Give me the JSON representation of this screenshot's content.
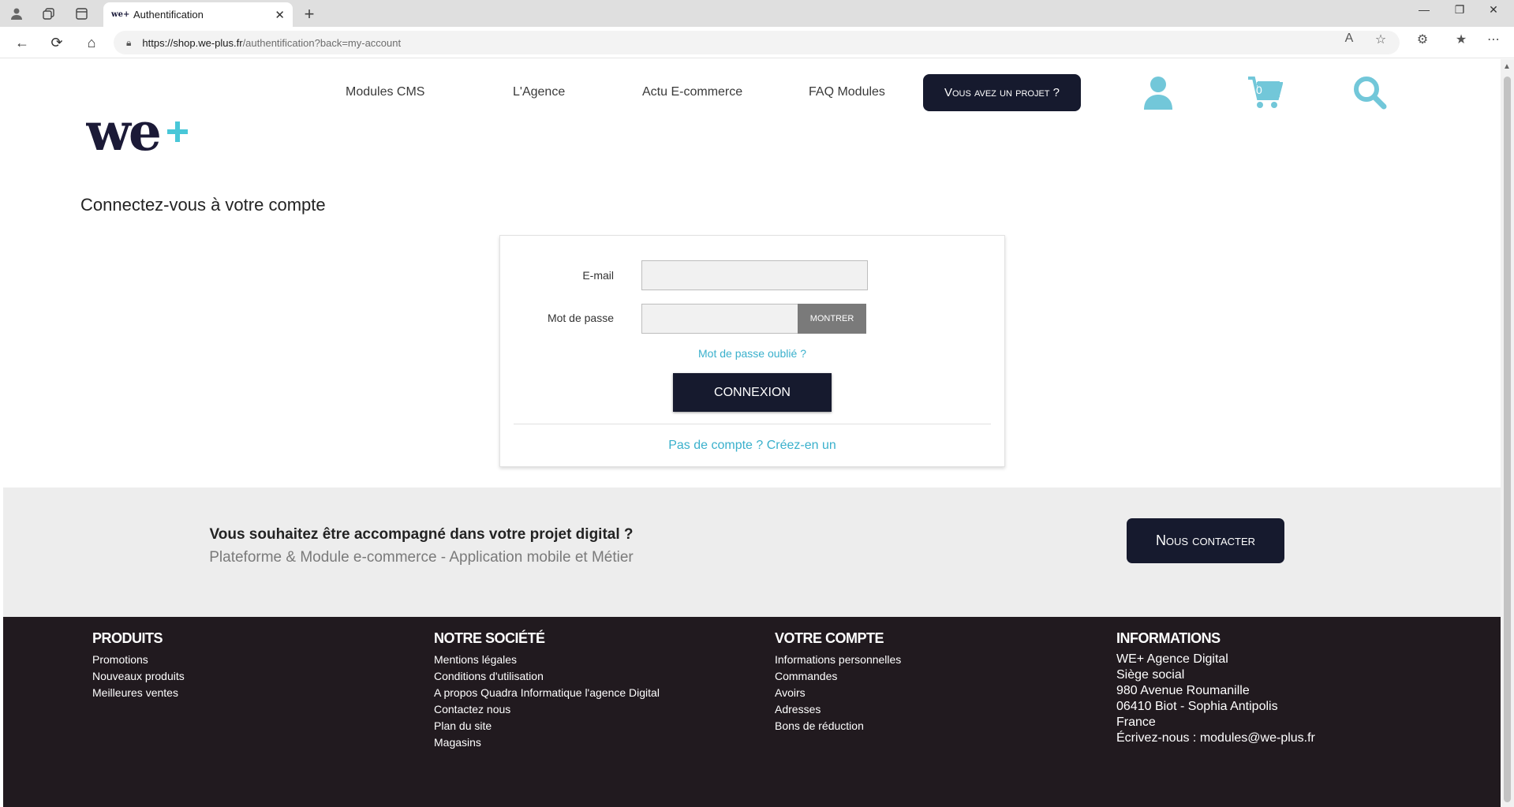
{
  "browser": {
    "tab_title": "Authentification",
    "tab_favicon": "we+",
    "url_host": "https://shop.we-plus.fr",
    "url_path": "/authentification?back=my-account"
  },
  "header": {
    "menu": [
      "Modules CMS",
      "L'Agence",
      "Actu E-commerce",
      "FAQ Modules"
    ],
    "project_button": "Vous avez un projet ?",
    "cart_count": "0",
    "logo_text": "we+"
  },
  "main": {
    "title": "Connectez-vous à votre compte",
    "email_label": "E-mail",
    "password_label": "Mot de passe",
    "email_value": "",
    "password_value": "",
    "show_button": "MONTRER",
    "forgot_link": "Mot de passe oublié ?",
    "submit_button": "CONNEXION",
    "create_account_link": "Pas de compte ? Créez-en un"
  },
  "cta": {
    "title": "Vous souhaitez être accompagné dans votre projet digital ?",
    "subtitle": "Plateforme & Module e-commerce - Application mobile et Métier",
    "button": "Nous contacter"
  },
  "footer": {
    "produits": {
      "title": "PRODUITS",
      "links": [
        "Promotions",
        "Nouveaux produits",
        "Meilleures ventes"
      ]
    },
    "societe": {
      "title": "NOTRE SOCIÉTÉ",
      "links": [
        "Mentions légales",
        "Conditions d'utilisation",
        "A propos Quadra Informatique l'agence Digital",
        "Contactez nous",
        "Plan du site",
        "Magasins"
      ]
    },
    "compte": {
      "title": "VOTRE COMPTE",
      "links": [
        "Informations personnelles",
        "Commandes",
        "Avoirs",
        "Adresses",
        "Bons de réduction"
      ]
    },
    "informations": {
      "title": "INFORMATIONS",
      "lines": [
        "WE+ Agence Digital",
        "Siège social",
        "980 Avenue Roumanille",
        "06410 Biot - Sophia Antipolis",
        "France",
        "Écrivez-nous : modules@we-plus.fr"
      ]
    }
  },
  "colors": {
    "accent": "#49c7d8",
    "navy": "#161a2e",
    "footer_bg": "#211a1f",
    "link": "#3ab0cc"
  }
}
